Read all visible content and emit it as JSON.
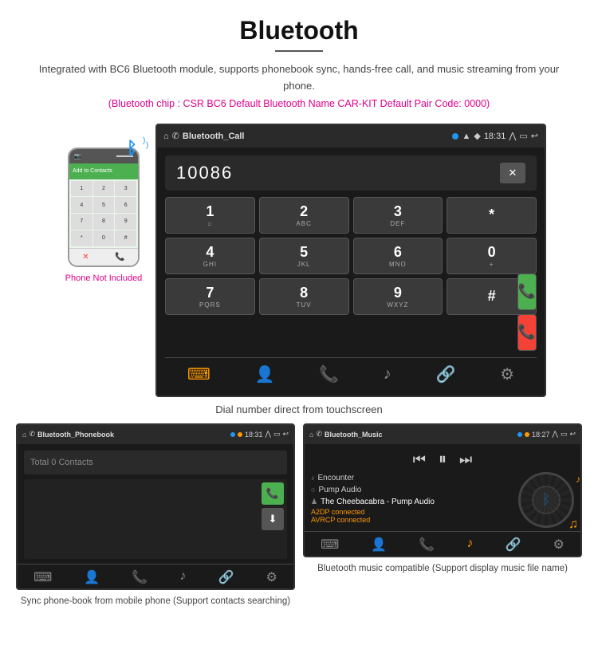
{
  "page": {
    "title": "Bluetooth",
    "subtitle": "Integrated with BC6 Bluetooth module, supports phonebook sync, hands-free call, and music streaming from your phone.",
    "specs": "(Bluetooth chip : CSR BC6    Default Bluetooth Name CAR-KIT    Default Pair Code: 0000)",
    "main_caption": "Dial number direct from touchscreen",
    "bottom_left_caption": "Sync phone-book from mobile phone\n(Support contacts searching)",
    "bottom_right_caption": "Bluetooth music compatible\n(Support display music file name)"
  },
  "phone": {
    "label": "Phone Not Included",
    "bt_symbol": "ᛒ"
  },
  "car_screen": {
    "statusbar": {
      "title": "Bluetooth_Call",
      "time": "18:31"
    },
    "dialpad": {
      "number": "10086",
      "keys": [
        {
          "main": "1",
          "sub": "⌂"
        },
        {
          "main": "2",
          "sub": "ABC"
        },
        {
          "main": "3",
          "sub": "DEF"
        },
        {
          "main": "*",
          "sub": ""
        },
        {
          "main": "4",
          "sub": "GHI"
        },
        {
          "main": "5",
          "sub": "JKL"
        },
        {
          "main": "6",
          "sub": "MNO"
        },
        {
          "main": "0",
          "sub": "+"
        },
        {
          "main": "7",
          "sub": "PQRS"
        },
        {
          "main": "8",
          "sub": "TUV"
        },
        {
          "main": "9",
          "sub": "WXYZ"
        },
        {
          "main": "#",
          "sub": ""
        }
      ]
    }
  },
  "phonebook_screen": {
    "statusbar_title": "Bluetooth_Phonebook",
    "time": "18:31",
    "search_placeholder": "Total 0 Contacts"
  },
  "music_screen": {
    "statusbar_title": "Bluetooth_Music",
    "time": "18:27",
    "tracks": [
      {
        "icon": "♪",
        "name": "Encounter"
      },
      {
        "icon": "○",
        "name": "Pump Audio"
      },
      {
        "icon": "♟",
        "name": "The Cheebacabra - Pump Audio"
      }
    ],
    "connected_lines": [
      "A2DP connected",
      "AVRCP connected"
    ]
  }
}
